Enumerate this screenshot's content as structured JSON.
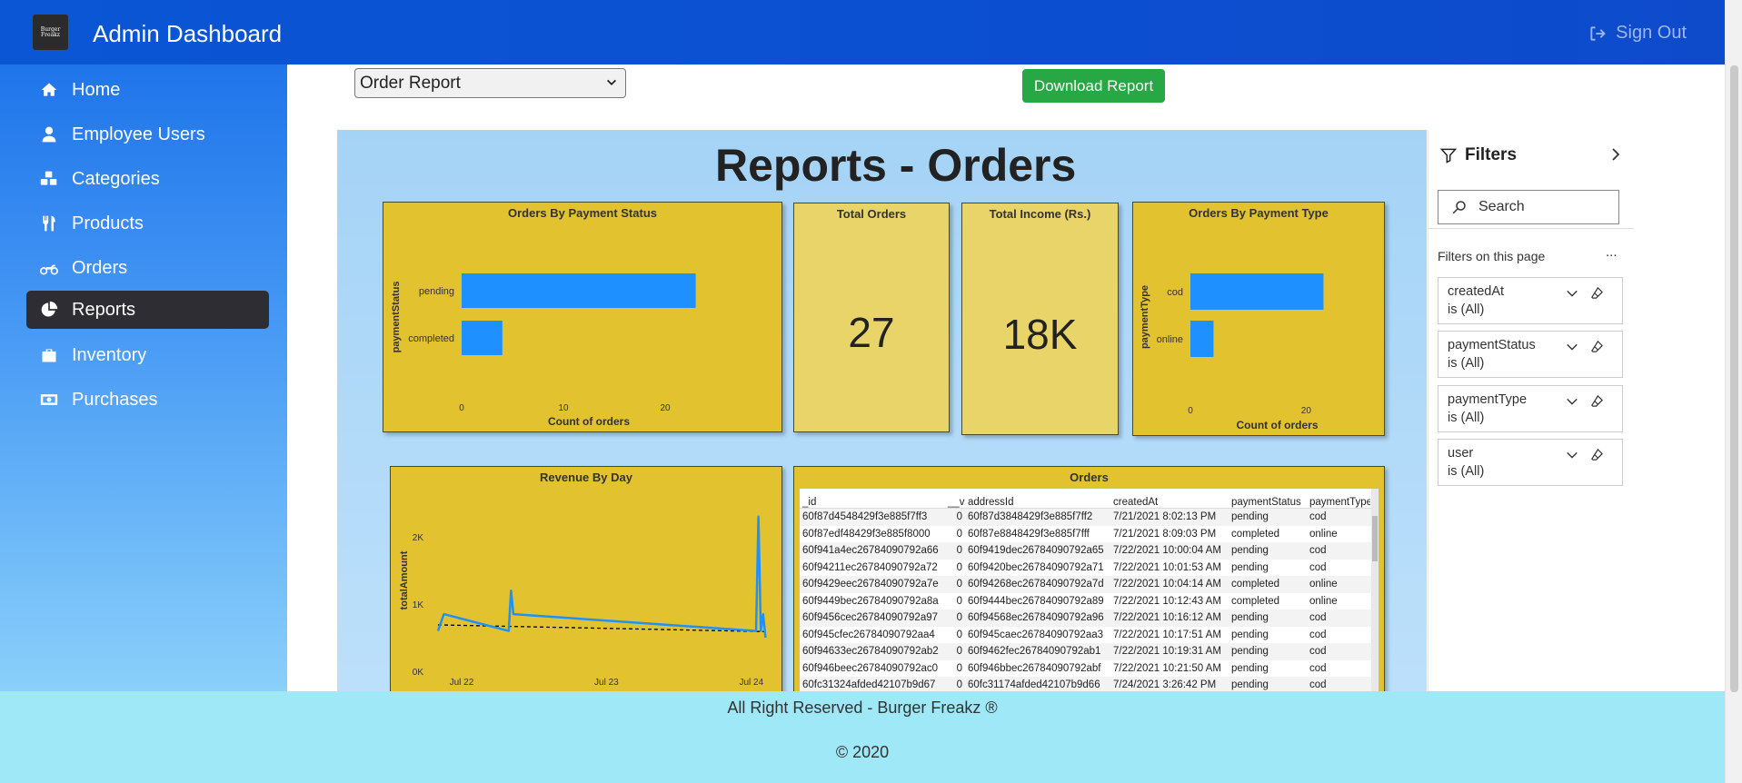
{
  "header": {
    "logo_text": "Burger Freakz",
    "title": "Admin Dashboard",
    "signout_label": "Sign Out"
  },
  "sidebar": {
    "items": [
      {
        "label": "Home",
        "icon": "home-icon"
      },
      {
        "label": "Employee Users",
        "icon": "user-icon"
      },
      {
        "label": "Categories",
        "icon": "cubes-icon"
      },
      {
        "label": "Products",
        "icon": "utensils-icon"
      },
      {
        "label": "Orders",
        "icon": "motorcycle-icon"
      },
      {
        "label": "Reports",
        "icon": "pie-chart-icon",
        "active": true
      },
      {
        "label": "Inventory",
        "icon": "briefcase-icon"
      },
      {
        "label": "Purchases",
        "icon": "money-bill-icon"
      }
    ]
  },
  "toolbar": {
    "report_select_value": "Order Report",
    "download_label": "Download Report"
  },
  "report": {
    "title": "Reports - Orders",
    "tiles": {
      "payment_status": {
        "title": "Orders By Payment Status"
      },
      "total_orders": {
        "title": "Total Orders",
        "value": "27"
      },
      "total_income": {
        "title": "Total Income (Rs.)",
        "value": "18K"
      },
      "payment_type": {
        "title": "Orders By Payment Type"
      },
      "revenue": {
        "title": "Revenue By Day"
      },
      "orders": {
        "title": "Orders"
      }
    }
  },
  "chart_data": [
    {
      "type": "bar",
      "orientation": "horizontal",
      "title": "Orders By Payment Status",
      "xlabel": "Count of orders",
      "ylabel": "paymentStatus",
      "categories": [
        "pending",
        "completed"
      ],
      "values": [
        23,
        4
      ],
      "xlim": [
        0,
        25
      ],
      "xticks": [
        "0",
        "10",
        "20"
      ],
      "color": "#1e90ff"
    },
    {
      "type": "bar",
      "orientation": "horizontal",
      "title": "Orders By Payment Type",
      "xlabel": "Count of orders",
      "ylabel": "paymentType",
      "categories": [
        "cod",
        "online"
      ],
      "values": [
        23,
        4
      ],
      "xlim": [
        0,
        30
      ],
      "xticks": [
        "0",
        "20"
      ],
      "color": "#1e90ff"
    },
    {
      "type": "line",
      "title": "Revenue By Day",
      "ylabel": "totalAmount",
      "xticks": [
        "Jul 22",
        "Jul 23",
        "Jul 24"
      ],
      "yticks": [
        "0K",
        "1K",
        "2K"
      ],
      "ylim": [
        0,
        2500
      ],
      "series": [
        {
          "values": [
            [
              0.0,
              600
            ],
            [
              0.05,
              850
            ],
            [
              0.6,
              600
            ],
            [
              0.62,
              1200
            ],
            [
              0.64,
              850
            ],
            [
              2.7,
              600
            ],
            [
              2.72,
              2300
            ],
            [
              2.74,
              600
            ],
            [
              2.76,
              850
            ],
            [
              2.78,
              500
            ]
          ],
          "color": "#1e90ff"
        }
      ],
      "trendline": {
        "values": [
          [
            0.0,
            690
          ],
          [
            2.78,
            590
          ]
        ],
        "color": "#000000",
        "style": "dashed"
      },
      "color": "#1e90ff"
    }
  ],
  "orders_table": {
    "columns": [
      "_id",
      "__v",
      "addressId",
      "createdAt",
      "paymentStatus",
      "paymentType"
    ],
    "rows": [
      [
        "60f87d4548429f3e885f7ff3",
        "0",
        "60f87d3848429f3e885f7ff2",
        "7/21/2021 8:02:13 PM",
        "pending",
        "cod"
      ],
      [
        "60f87edf48429f3e885f8000",
        "0",
        "60f87e8848429f3e885f7fff",
        "7/21/2021 8:09:03 PM",
        "completed",
        "online"
      ],
      [
        "60f941a4ec26784090792a66",
        "0",
        "60f9419dec26784090792a65",
        "7/22/2021 10:00:04 AM",
        "pending",
        "cod"
      ],
      [
        "60f94211ec26784090792a72",
        "0",
        "60f9420bec26784090792a71",
        "7/22/2021 10:01:53 AM",
        "pending",
        "cod"
      ],
      [
        "60f9429eec26784090792a7e",
        "0",
        "60f94268ec26784090792a7d",
        "7/22/2021 10:04:14 AM",
        "completed",
        "online"
      ],
      [
        "60f9449bec26784090792a8a",
        "0",
        "60f9444bec26784090792a89",
        "7/22/2021 10:12:43 AM",
        "completed",
        "online"
      ],
      [
        "60f9456cec26784090792a97",
        "0",
        "60f94568ec26784090792a96",
        "7/22/2021 10:16:12 AM",
        "pending",
        "cod"
      ],
      [
        "60f945cfec26784090792aa4",
        "0",
        "60f945caec26784090792aa3",
        "7/22/2021 10:17:51 AM",
        "pending",
        "cod"
      ],
      [
        "60f94633ec26784090792ab2",
        "0",
        "60f9462fec26784090792ab1",
        "7/22/2021 10:19:31 AM",
        "pending",
        "cod"
      ],
      [
        "60f946beec26784090792ac0",
        "0",
        "60f946bbec26784090792abf",
        "7/22/2021 10:21:50 AM",
        "pending",
        "cod"
      ],
      [
        "60fc31324afded42107b9d67",
        "0",
        "60fc31174afded42107b9d66",
        "7/24/2021 3:26:42 PM",
        "pending",
        "cod"
      ]
    ]
  },
  "filters_pane": {
    "title": "Filters",
    "search_placeholder": "Search",
    "section_label": "Filters on this page",
    "more_label": "...",
    "filters": [
      {
        "name": "createdAt",
        "value": "is (All)"
      },
      {
        "name": "paymentStatus",
        "value": "is (All)"
      },
      {
        "name": "paymentType",
        "value": "is (All)"
      },
      {
        "name": "user",
        "value": "is (All)"
      }
    ]
  },
  "footer": {
    "line1": "All Right Reserved - Burger Freakz ®",
    "line2": "© 2020"
  }
}
